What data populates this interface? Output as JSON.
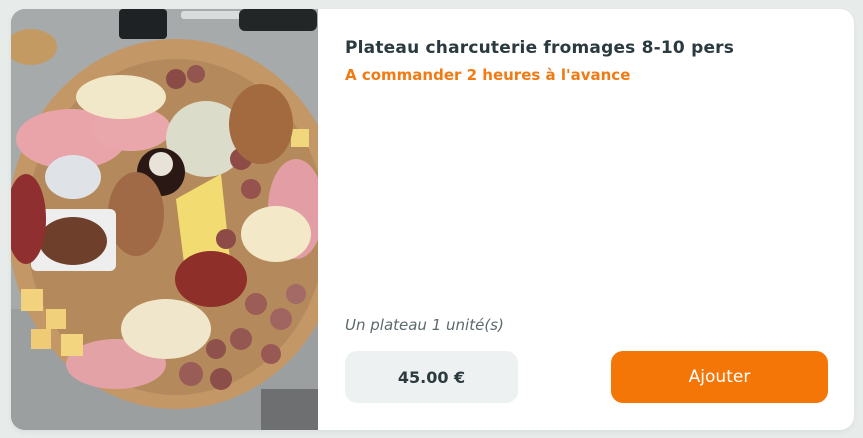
{
  "product": {
    "title": "Plateau charcuterie fromages 8-10 pers",
    "notice": "A commander 2 heures à l'avance",
    "unit_label": "Un plateau 1 unité(s)",
    "price": "45.00 €",
    "add_button_label": "Ajouter",
    "image_icon": "charcuterie-platter-photo"
  },
  "colors": {
    "accent": "#f47607",
    "notice": "#f27a12",
    "title": "#2b3a3f",
    "price_bg": "#eef1f1"
  }
}
